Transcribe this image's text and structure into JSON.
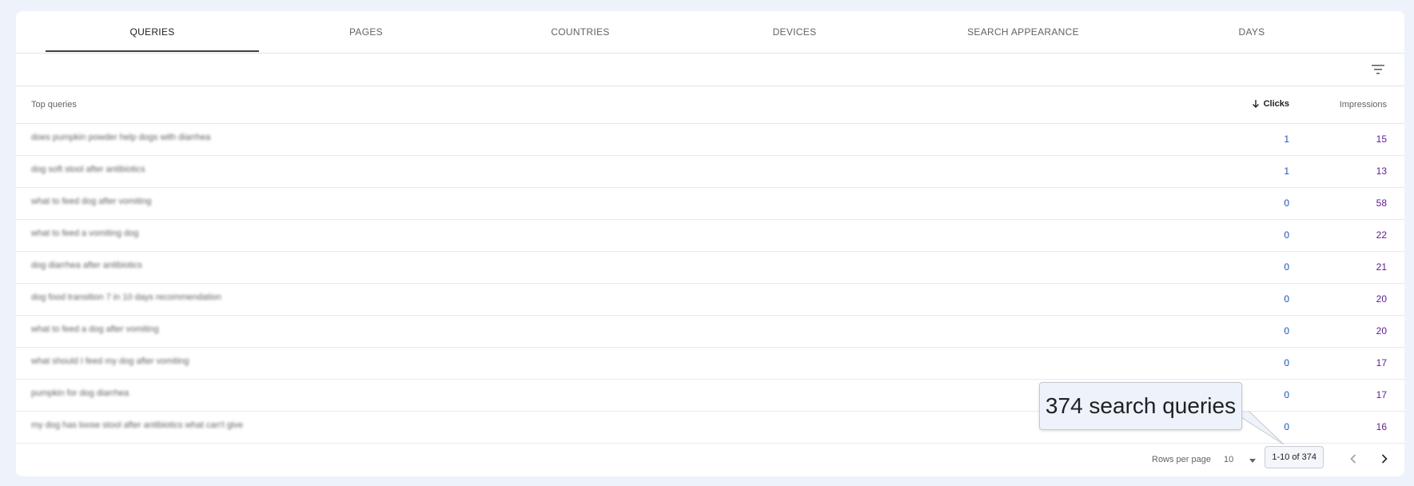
{
  "tabs": [
    {
      "label": "QUERIES"
    },
    {
      "label": "PAGES"
    },
    {
      "label": "COUNTRIES"
    },
    {
      "label": "DEVICES"
    },
    {
      "label": "SEARCH APPEARANCE"
    },
    {
      "label": "DAYS"
    }
  ],
  "active_tab": "QUERIES",
  "filter": {
    "icon": "filter-icon"
  },
  "table": {
    "headers": {
      "query": "Top queries",
      "clicks": "Clicks",
      "impressions": "Impressions"
    },
    "sort": {
      "column": "Clicks",
      "direction": "descending",
      "icon": "arrow-down-icon"
    },
    "rows": [
      {
        "query": "does pumpkin powder help dogs with diarrhea",
        "clicks": "1",
        "impressions": "15"
      },
      {
        "query": "dog soft stool after antibiotics",
        "clicks": "1",
        "impressions": "13"
      },
      {
        "query": "what to feed dog after vomiting",
        "clicks": "0",
        "impressions": "58"
      },
      {
        "query": "what to feed a vomiting dog",
        "clicks": "0",
        "impressions": "22"
      },
      {
        "query": "dog diarrhea after antibiotics",
        "clicks": "0",
        "impressions": "21"
      },
      {
        "query": "dog food transition 7 in 10 days recommendation",
        "clicks": "0",
        "impressions": "20"
      },
      {
        "query": "what to feed a dog after vomiting",
        "clicks": "0",
        "impressions": "20"
      },
      {
        "query": "what should I feed my dog after vomiting",
        "clicks": "0",
        "impressions": "17"
      },
      {
        "query": "pumpkin for dog diarrhea",
        "clicks": "0",
        "impressions": "17"
      },
      {
        "query": "my dog has loose stool after antibiotics what can't give",
        "clicks": "0",
        "impressions": "16"
      }
    ]
  },
  "pagination": {
    "rows_per_page_label": "Rows per page",
    "rows_per_page_value": "10",
    "range": "1-10 of 374",
    "prev_icon": "chevron-left-icon",
    "next_icon": "chevron-right-icon"
  },
  "callout": {
    "text": "374 search queries"
  },
  "colors": {
    "clicks": "#1a57b5",
    "impressions": "#5e1b91",
    "background": "#eef2fb"
  }
}
